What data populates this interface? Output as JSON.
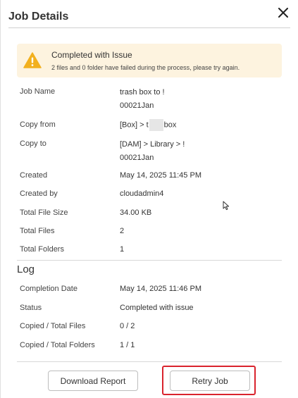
{
  "dialog": {
    "title": "Job Details"
  },
  "alert": {
    "title": "Completed with Issue",
    "message": "2 files and 0 folder have failed during the process, please try again.",
    "icon": "warning-icon",
    "icon_color": "#f2b01e",
    "background": "#fdf3df"
  },
  "details": {
    "job_name_label": "Job Name",
    "job_name_line1": "trash box to !",
    "job_name_line2": "00021Jan",
    "copy_from_label": "Copy from",
    "copy_from_value_prefix": "[Box]  > t",
    "copy_from_value_suffix": "box",
    "copy_to_label": "Copy to",
    "copy_to_line1": "[DAM]  > Library > !",
    "copy_to_line2": "00021Jan",
    "created_label": "Created",
    "created_value": "May 14, 2025 11:45 PM",
    "created_by_label": "Created by",
    "created_by_value": "cloudadmin4",
    "total_file_size_label": "Total File Size",
    "total_file_size_value": "34.00 KB",
    "total_files_label": "Total Files",
    "total_files_value": "2",
    "total_folders_label": "Total Folders",
    "total_folders_value": "1"
  },
  "log": {
    "title": "Log",
    "completion_date_label": "Completion Date",
    "completion_date_value": "May 14, 2025 11:46 PM",
    "status_label": "Status",
    "status_value": "Completed with issue",
    "copied_files_label": "Copied / Total Files",
    "copied_files_value": "0 / 2",
    "copied_folders_label": "Copied / Total Folders",
    "copied_folders_value": "1 / 1"
  },
  "footer": {
    "download_label": "Download Report",
    "retry_label": "Retry Job",
    "highlight_color": "#d9232d"
  }
}
